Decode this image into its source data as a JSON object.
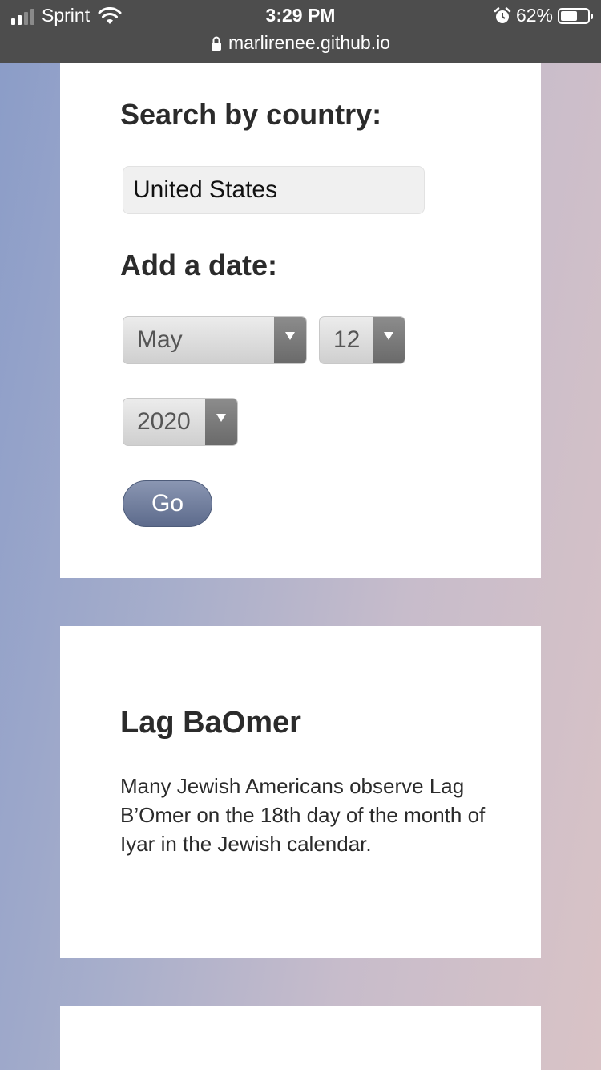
{
  "status_bar": {
    "carrier": "Sprint",
    "time": "3:29 PM",
    "battery_percent": "62%",
    "battery_level": 0.62,
    "signal_bars": 2,
    "icons": [
      "signal-icon",
      "wifi-icon",
      "alarm-icon",
      "battery-icon",
      "lock-icon"
    ]
  },
  "browser": {
    "url": "marlirenee.github.io"
  },
  "search": {
    "country_heading": "Search by country:",
    "country_value": "United States",
    "date_heading": "Add a date:",
    "month_value": "May",
    "day_value": "12",
    "year_value": "2020",
    "go_label": "Go"
  },
  "holiday": {
    "title": "Lag BaOmer",
    "description": "Many Jewish Americans observe Lag B’Omer on the 18th day of the month of Iyar in the Jewish calendar."
  },
  "colors": {
    "status_bar": "#4d4d4d",
    "card": "#ffffff",
    "go_button": "#6f7c9c",
    "heading_text": "#2b2b2b"
  }
}
